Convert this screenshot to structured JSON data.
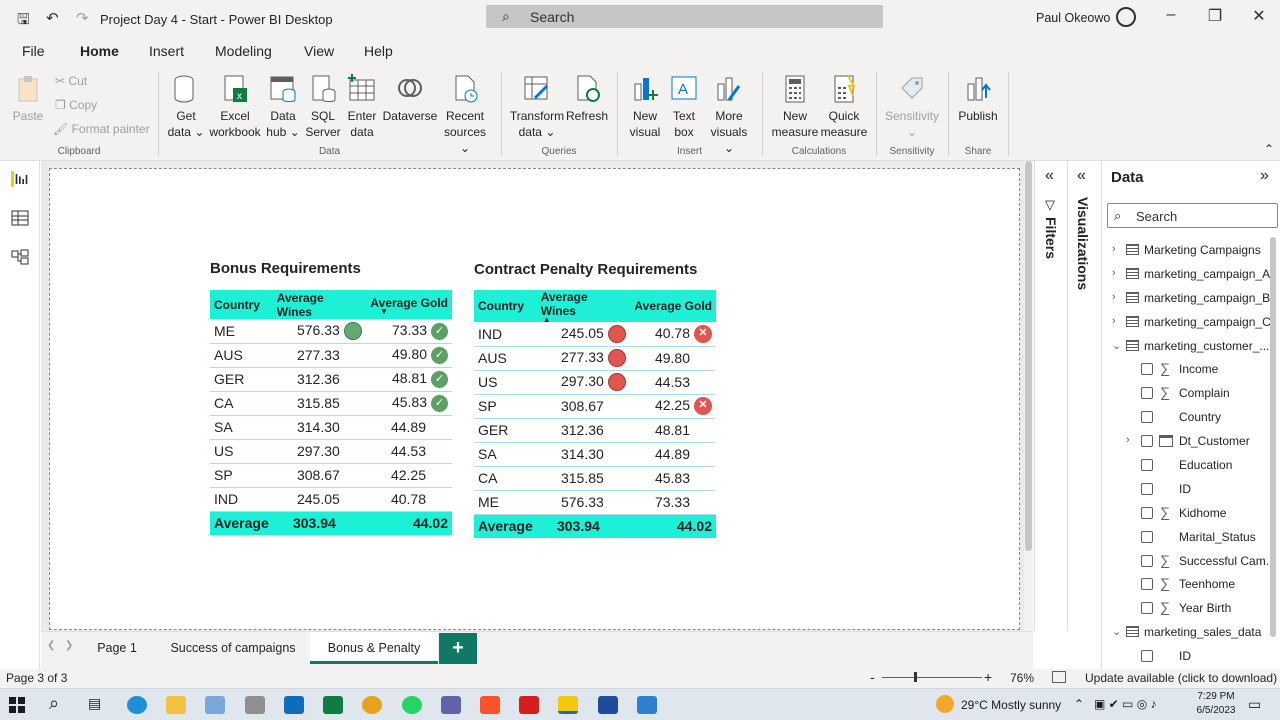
{
  "titlebar": {
    "title": "Project Day 4 - Start - Power BI Desktop",
    "search": "Search",
    "user": "Paul Okeowo"
  },
  "menu": [
    "File",
    "Home",
    "Insert",
    "Modeling",
    "View",
    "Help"
  ],
  "ribbon": {
    "paste": "Paste",
    "cut": "Cut",
    "copy": "Copy",
    "format_painter": "Format painter",
    "get_data": "Get data",
    "excel": "Excel workbook",
    "data_hub": "Data hub",
    "sql": "SQL Server",
    "enter_data": "Enter data",
    "dataverse": "Dataverse",
    "recent": "Recent sources",
    "transform": "Transform data",
    "refresh": "Refresh",
    "new_visual": "New visual",
    "text_box": "Text box",
    "more_visuals": "More visuals",
    "new_measure": "New measure",
    "quick_measure": "Quick measure",
    "sensitivity": "Sensitivity",
    "publish": "Publish",
    "groups": {
      "clipboard": "Clipboard",
      "data": "Data",
      "queries": "Queries",
      "insert": "Insert",
      "calculations": "Calculations",
      "sensitivity": "Sensitivity",
      "share": "Share"
    }
  },
  "bonus": {
    "title": "Bonus Requirements",
    "headers": [
      "Country",
      "Average Wines",
      "Average Gold"
    ],
    "rows": [
      {
        "country": "ME",
        "wines": "576.33",
        "gold": "73.33",
        "wines_icon": "green-circle",
        "gold_icon": "check"
      },
      {
        "country": "AUS",
        "wines": "277.33",
        "gold": "49.80",
        "wines_icon": "",
        "gold_icon": "check"
      },
      {
        "country": "GER",
        "wines": "312.36",
        "gold": "48.81",
        "wines_icon": "",
        "gold_icon": "check"
      },
      {
        "country": "CA",
        "wines": "315.85",
        "gold": "45.83",
        "wines_icon": "",
        "gold_icon": "check"
      },
      {
        "country": "SA",
        "wines": "314.30",
        "gold": "44.89",
        "wines_icon": "",
        "gold_icon": ""
      },
      {
        "country": "US",
        "wines": "297.30",
        "gold": "44.53",
        "wines_icon": "",
        "gold_icon": ""
      },
      {
        "country": "SP",
        "wines": "308.67",
        "gold": "42.25",
        "wines_icon": "",
        "gold_icon": ""
      },
      {
        "country": "IND",
        "wines": "245.05",
        "gold": "40.78",
        "wines_icon": "",
        "gold_icon": ""
      }
    ],
    "total": {
      "label": "Average",
      "wines": "303.94",
      "gold": "44.02"
    }
  },
  "penalty": {
    "title": "Contract Penalty Requirements",
    "headers": [
      "Country",
      "Average Wines",
      "Average Gold"
    ],
    "rows": [
      {
        "country": "IND",
        "wines": "245.05",
        "gold": "40.78",
        "wines_icon": "red-circle",
        "gold_icon": "x"
      },
      {
        "country": "AUS",
        "wines": "277.33",
        "gold": "49.80",
        "wines_icon": "red-circle",
        "gold_icon": ""
      },
      {
        "country": "US",
        "wines": "297.30",
        "gold": "44.53",
        "wines_icon": "red-circle",
        "gold_icon": ""
      },
      {
        "country": "SP",
        "wines": "308.67",
        "gold": "42.25",
        "wines_icon": "",
        "gold_icon": "x"
      },
      {
        "country": "GER",
        "wines": "312.36",
        "gold": "48.81",
        "wines_icon": "",
        "gold_icon": ""
      },
      {
        "country": "SA",
        "wines": "314.30",
        "gold": "44.89",
        "wines_icon": "",
        "gold_icon": ""
      },
      {
        "country": "CA",
        "wines": "315.85",
        "gold": "45.83",
        "wines_icon": "",
        "gold_icon": ""
      },
      {
        "country": "ME",
        "wines": "576.33",
        "gold": "73.33",
        "wines_icon": "",
        "gold_icon": ""
      }
    ],
    "total": {
      "label": "Average",
      "wines": "303.94",
      "gold": "44.02"
    }
  },
  "panes": {
    "filters": "Filters",
    "visualizations": "Visualizations",
    "data": "Data",
    "search": "Search"
  },
  "tree": [
    {
      "label": "Marketing Campaigns",
      "kind": "table",
      "expanded": false
    },
    {
      "label": "marketing_campaign_A",
      "kind": "table",
      "expanded": false
    },
    {
      "label": "marketing_campaign_B",
      "kind": "table",
      "expanded": false
    },
    {
      "label": "marketing_campaign_C",
      "kind": "table",
      "expanded": false
    },
    {
      "label": "marketing_customer_...",
      "kind": "table",
      "expanded": true
    },
    {
      "label": "Income",
      "kind": "measure"
    },
    {
      "label": "Complain",
      "kind": "measure"
    },
    {
      "label": "Country",
      "kind": "field"
    },
    {
      "label": "Dt_Customer",
      "kind": "date"
    },
    {
      "label": "Education",
      "kind": "field"
    },
    {
      "label": "ID",
      "kind": "field"
    },
    {
      "label": "Kidhome",
      "kind": "measure"
    },
    {
      "label": "Marital_Status",
      "kind": "field"
    },
    {
      "label": "Successful Cam...",
      "kind": "measure"
    },
    {
      "label": "Teenhome",
      "kind": "measure"
    },
    {
      "label": "Year Birth",
      "kind": "measure"
    },
    {
      "label": "marketing_sales_data",
      "kind": "table",
      "expanded": true
    },
    {
      "label": "ID",
      "kind": "field"
    }
  ],
  "pages": [
    "Page 1",
    "Success of campaigns",
    "Bonus & Penalty"
  ],
  "add_page": "+",
  "status": {
    "page": "Page 3 of 3",
    "zoom": "76%",
    "update": "Update available (click to download)"
  },
  "taskbar": {
    "weather": "29°C  Mostly sunny",
    "time": "7:29 PM",
    "date": "6/5/2023"
  },
  "colors": {
    "accent": "#117865",
    "header": "#1ef0d8"
  }
}
